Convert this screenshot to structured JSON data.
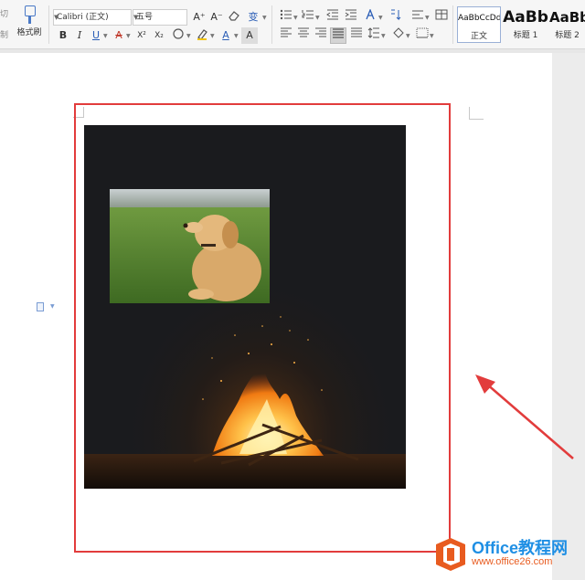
{
  "toolbar": {
    "cut_label": "切",
    "copy_label": "制",
    "format_painter_label": "格式刷",
    "font_name": "Calibri (正文)",
    "font_size": "五号",
    "bold_label": "B",
    "italic_label": "I",
    "underline_label": "U",
    "strike_label": "A",
    "superscript_label": "X²",
    "subscript_label": "X₂",
    "grow_font_label": "A⁺",
    "shrink_font_label": "A⁻",
    "pinyin_label": "变",
    "font_color_label": "A",
    "char_shade_label": "A"
  },
  "styles": [
    {
      "preview": "AaBbCcDd",
      "name": "正文"
    },
    {
      "preview": "AaBb",
      "name": "标题 1"
    },
    {
      "preview": "AaBb",
      "name": "标题 2"
    }
  ],
  "colors": {
    "red_frame": "#e23c3c",
    "arrow": "#e23c3c",
    "brand_blue": "#1f8fe4",
    "brand_orange": "#e85b1f"
  },
  "watermark": {
    "title": "Office教程网",
    "url": "www.office26.com"
  }
}
